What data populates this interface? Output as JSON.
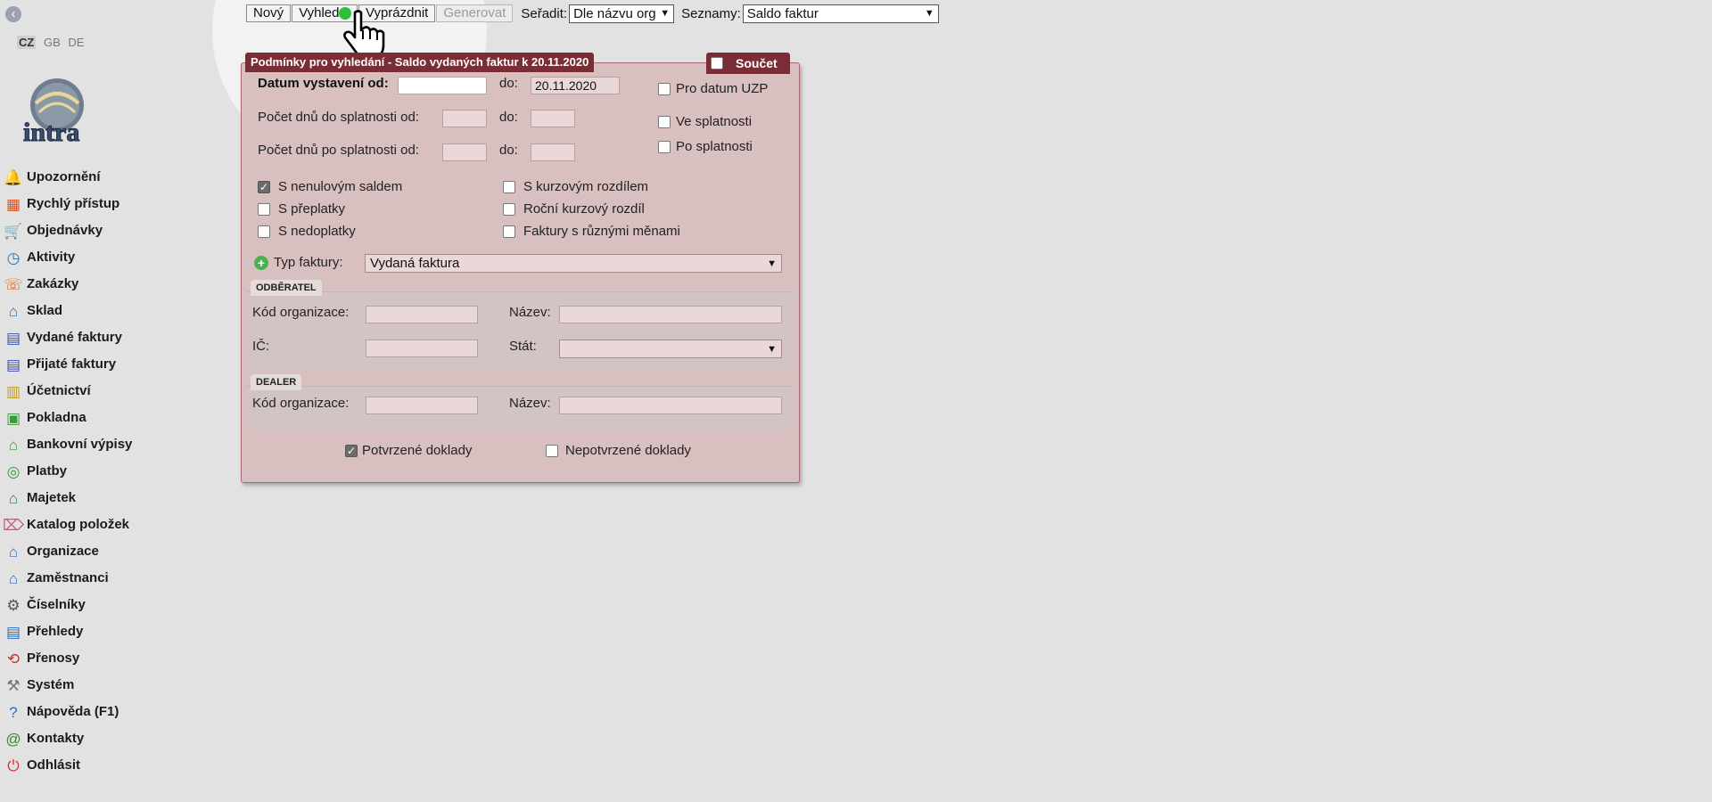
{
  "sidebar": {
    "langs": [
      "CZ",
      "GB",
      "DE"
    ],
    "logo_text": "intra",
    "items": [
      {
        "label": "Upozornění",
        "icon": "bell-icon",
        "glyph": "🔔",
        "color": "#e07a1f"
      },
      {
        "label": "Rychlý přístup",
        "icon": "quick-access-icon",
        "glyph": "▦",
        "color": "#d9531e"
      },
      {
        "label": "Objednávky",
        "icon": "cart-icon",
        "glyph": "🛒",
        "color": "#2e8b2e"
      },
      {
        "label": "Aktivity",
        "icon": "clock-icon",
        "glyph": "◷",
        "color": "#2a6fb5"
      },
      {
        "label": "Zakázky",
        "icon": "orders-icon",
        "glyph": "☏",
        "color": "#d9661e"
      },
      {
        "label": "Sklad",
        "icon": "warehouse-icon",
        "glyph": "⌂",
        "color": "#2a6fb5"
      },
      {
        "label": "Vydané faktury",
        "icon": "issued-invoice-icon",
        "glyph": "▤",
        "color": "#3a52a8"
      },
      {
        "label": "Přijaté faktury",
        "icon": "received-invoice-icon",
        "glyph": "▤",
        "color": "#3a52a8"
      },
      {
        "label": "Účetnictví",
        "icon": "accounting-icon",
        "glyph": "▥",
        "color": "#c59a1e"
      },
      {
        "label": "Pokladna",
        "icon": "cash-icon",
        "glyph": "▣",
        "color": "#3a9a3a"
      },
      {
        "label": "Bankovní výpisy",
        "icon": "bank-icon",
        "glyph": "⌂",
        "color": "#3a9a3a"
      },
      {
        "label": "Platby",
        "icon": "payments-icon",
        "glyph": "◎",
        "color": "#3a9a3a"
      },
      {
        "label": "Majetek",
        "icon": "property-icon",
        "glyph": "⌂",
        "color": "#2e7d4a"
      },
      {
        "label": "Katalog položek",
        "icon": "tag-icon",
        "glyph": "⌦",
        "color": "#b0607a"
      },
      {
        "label": "Organizace",
        "icon": "organization-icon",
        "glyph": "⌂",
        "color": "#2a6fb5"
      },
      {
        "label": "Zaměstnanci",
        "icon": "employees-icon",
        "glyph": "⌂",
        "color": "#2a6fb5"
      },
      {
        "label": "Číselníky",
        "icon": "gear-icon",
        "glyph": "⚙",
        "color": "#555555"
      },
      {
        "label": "Přehledy",
        "icon": "reports-icon",
        "glyph": "▤",
        "color": "#2a6fb5"
      },
      {
        "label": "Přenosy",
        "icon": "transfer-icon",
        "glyph": "⟲",
        "color": "#c0392b"
      },
      {
        "label": "Systém",
        "icon": "wrench-icon",
        "glyph": "⚒",
        "color": "#777777"
      },
      {
        "label": "Nápověda (F1)",
        "icon": "help-icon",
        "glyph": "?",
        "color": "#2a6fb5"
      },
      {
        "label": "Kontakty",
        "icon": "at-icon",
        "glyph": "@",
        "color": "#2e8b2e"
      },
      {
        "label": "Odhlásit",
        "icon": "power-icon",
        "glyph": "⏻",
        "color": "#d62828"
      }
    ]
  },
  "toolbar": {
    "new_label": "Nový",
    "search_label": "Vyhledat",
    "clear_label": "Vyprázdnit",
    "generate_label": "Generovat",
    "sort_label": "Seřadit:",
    "sort_value": "Dle názvu org",
    "lists_label": "Seznamy:",
    "lists_value": "Saldo faktur"
  },
  "panel": {
    "title": "Podmínky pro vyhledání - Saldo vydaných faktur k 20.11.2020",
    "sum_label": "Součet",
    "date_from_label": "Datum vystavení od:",
    "date_from_value": "",
    "to_label": "do:",
    "date_to_value": "20.11.2020",
    "days_to_due_label": "Počet dnů do splatnosti od:",
    "days_after_due_label": "Počet dnů po splatnosti od:",
    "uzp_label": "Pro datum UZP",
    "in_due_label": "Ve splatnosti",
    "after_due_label": "Po splatnosti",
    "zero_balance_label": "S nenulovým saldem",
    "overpaid_label": "S přeplatky",
    "underpaid_label": "S nedoplatky",
    "fx_diff_label": "S kurzovým rozdílem",
    "yearly_fx_label": "Roční kurzový rozdíl",
    "multi_currency_label": "Faktury s různými měnami",
    "invoice_type_label": "Typ faktury:",
    "invoice_type_value": "Vydaná faktura",
    "customer_section": "ODBĚRATEL",
    "org_code_label": "Kód organizace:",
    "name_label": "Název:",
    "ic_label": "IČ:",
    "state_label": "Stát:",
    "dealer_section": "DEALER",
    "confirmed_label": "Potvrzené doklady",
    "unconfirmed_label": "Nepotvrzené doklady"
  }
}
